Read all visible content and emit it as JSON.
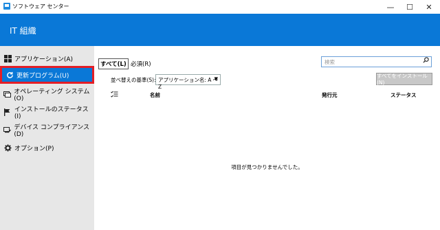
{
  "window": {
    "title": "ソフトウェア センター",
    "controls": {
      "minimize": "—",
      "maximize": "☐",
      "close": "✕"
    }
  },
  "header": {
    "title": "IT 組織"
  },
  "sidebar": {
    "items": [
      {
        "label": "アプリケーション(A)",
        "icon": "apps-grid-icon"
      },
      {
        "label": "更新プログラム(U)",
        "icon": "refresh-icon",
        "active": true
      },
      {
        "label": "オペレーティング システム(O)",
        "icon": "os-window-icon"
      },
      {
        "label": "インストールのステータス(I)",
        "icon": "flag-icon"
      },
      {
        "label": "デバイス コンプライアンス(D)",
        "icon": "device-compliance-icon"
      },
      {
        "label": "オプション(P)",
        "icon": "gear-icon"
      }
    ]
  },
  "main": {
    "tabs": [
      {
        "label": "すべて(L)",
        "active": true
      },
      {
        "label": "必須(R)"
      }
    ],
    "search": {
      "placeholder": "検索"
    },
    "sort": {
      "label": "並べ替えの基準(S):",
      "value": "アプリケーション名: A 〜 Z"
    },
    "install_all_label": "すべてをインストール(N)",
    "columns": {
      "name": "名前",
      "publisher": "発行元",
      "status": "ステータス"
    },
    "empty_message": "項目が見つかりませんでした。"
  },
  "colors": {
    "accent": "#0a78d7",
    "highlight_outline": "#e41e26",
    "sidebar_bg": "#e7e7e7"
  }
}
